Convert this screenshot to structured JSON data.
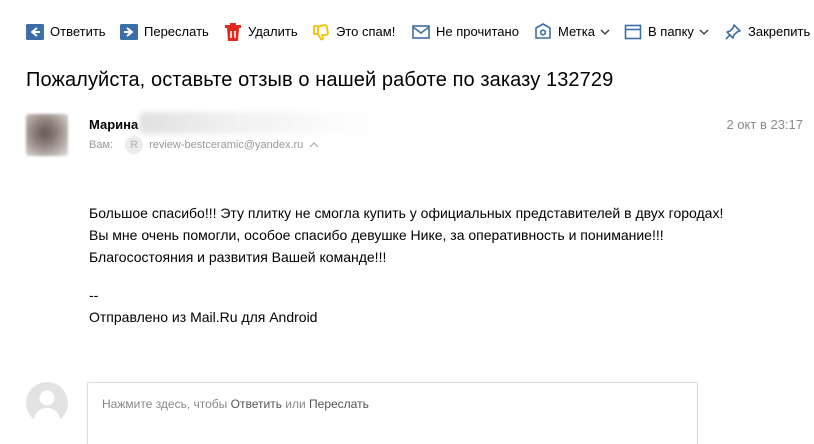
{
  "toolbar": {
    "reply": {
      "label": "Ответить",
      "icon": "reply-icon"
    },
    "forward": {
      "label": "Переслать",
      "icon": "forward-icon"
    },
    "delete": {
      "label": "Удалить",
      "icon": "trash-icon"
    },
    "spam": {
      "label": "Это спам!",
      "icon": "thumbs-down-icon"
    },
    "unread": {
      "label": "Не прочитано",
      "icon": "envelope-icon"
    },
    "label": {
      "label": "Метка",
      "icon": "tag-icon"
    },
    "folder": {
      "label": "В папку",
      "icon": "folder-icon"
    },
    "pin": {
      "label": "Закрепить",
      "icon": "pin-icon"
    }
  },
  "message": {
    "subject": "Пожалуйста, оставьте отзыв о нашей работе по заказу 132729",
    "sender_name": "Марина",
    "date": "2 окт в 23:17",
    "to_label": "Вам:",
    "to_avatar_letter": "R",
    "to_email": "review-bestceramic@yandex.ru",
    "body_lines": [
      "Большое спасибо!!! Эту плитку не смогла купить у официальных представителей в двух городах!",
      "Вы мне очень помогли, особое спасибо девушке Нике,  за оперативность и понимание!!!",
      "Благосостояния и развития Вашей команде!!!"
    ],
    "signature_separator": "--",
    "signature": "Отправлено из Mail.Ru для Android"
  },
  "reply_box": {
    "hint_prefix": "Нажмите здесь, чтобы ",
    "reply_link": "Ответить",
    "hint_middle": " или ",
    "forward_link": "Переслать"
  },
  "colors": {
    "icon_blue": "#3d6ea8",
    "delete_red": "#e0291f",
    "spam_yellow": "#f2c200",
    "muted_text": "#8a8a8a"
  }
}
